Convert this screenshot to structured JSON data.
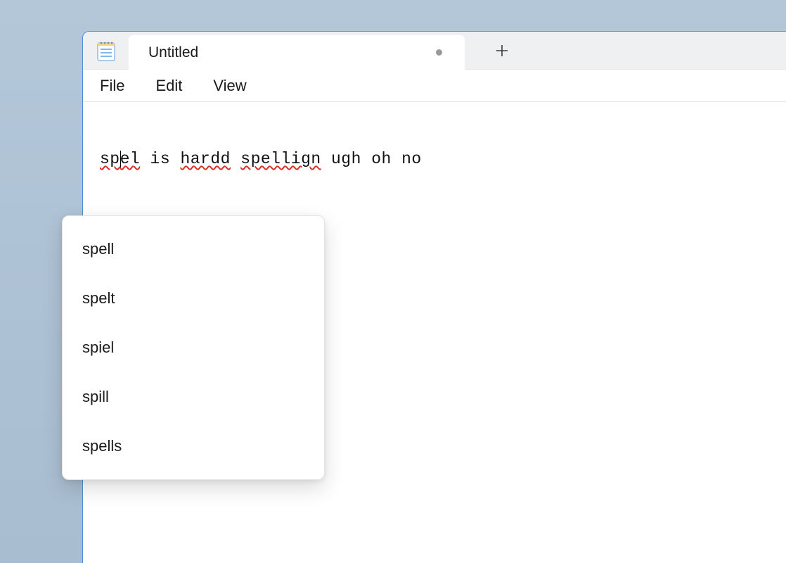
{
  "app": {
    "tab_title": "Untitled"
  },
  "menubar": {
    "file": "File",
    "edit": "Edit",
    "view": "View"
  },
  "editor": {
    "words": [
      {
        "text": "sp",
        "misspelled": true,
        "cursor_after": true
      },
      {
        "text": "el",
        "misspelled": true
      },
      {
        "text": " is ",
        "misspelled": false
      },
      {
        "text": "hardd",
        "misspelled": true
      },
      {
        "text": " ",
        "misspelled": false
      },
      {
        "text": "spellign",
        "misspelled": true
      },
      {
        "text": " ugh oh no",
        "misspelled": false
      }
    ],
    "full_text": "spel is hardd spellign ugh oh no"
  },
  "spellcheck_menu": {
    "suggestions": [
      "spell",
      "spelt",
      "spiel",
      "spill",
      "spells"
    ]
  }
}
